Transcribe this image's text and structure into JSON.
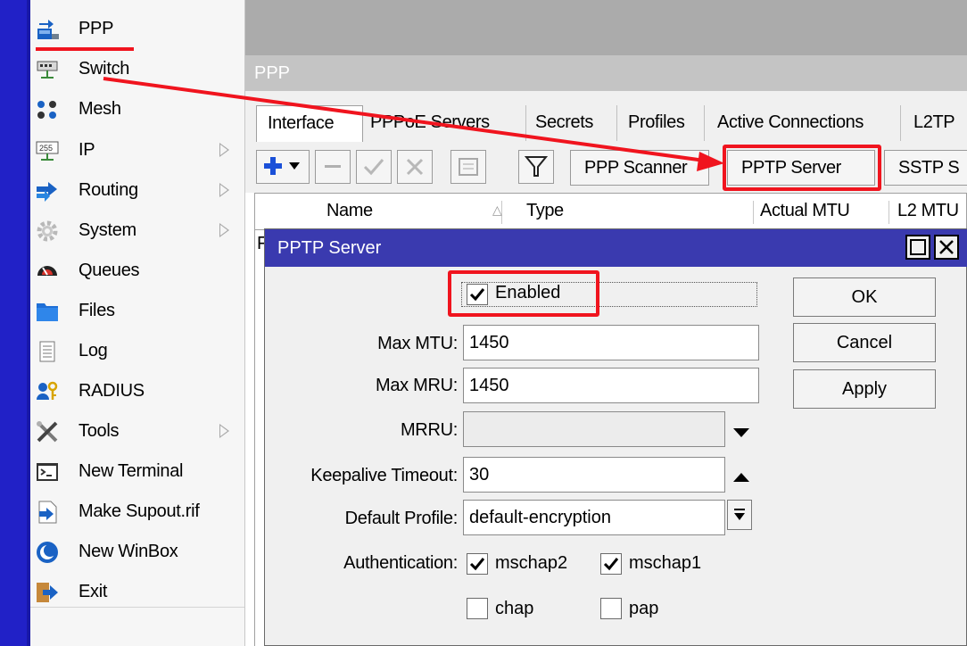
{
  "menu": {
    "items": [
      {
        "label": "PPP",
        "icon": "ppp-icon",
        "has_submenu": false
      },
      {
        "label": "Switch",
        "icon": "switch-icon",
        "has_submenu": false
      },
      {
        "label": "Mesh",
        "icon": "mesh-icon",
        "has_submenu": false
      },
      {
        "label": "IP",
        "icon": "ip-icon",
        "has_submenu": true
      },
      {
        "label": "Routing",
        "icon": "routing-icon",
        "has_submenu": true
      },
      {
        "label": "System",
        "icon": "gear-icon",
        "has_submenu": true
      },
      {
        "label": "Queues",
        "icon": "queues-icon",
        "has_submenu": false
      },
      {
        "label": "Files",
        "icon": "folder-icon",
        "has_submenu": false
      },
      {
        "label": "Log",
        "icon": "log-icon",
        "has_submenu": false
      },
      {
        "label": "RADIUS",
        "icon": "radius-icon",
        "has_submenu": false
      },
      {
        "label": "Tools",
        "icon": "tools-icon",
        "has_submenu": true
      },
      {
        "label": "New Terminal",
        "icon": "terminal-icon",
        "has_submenu": false
      },
      {
        "label": "Make Supout.rif",
        "icon": "supout-icon",
        "has_submenu": false
      },
      {
        "label": "New WinBox",
        "icon": "winbox-icon",
        "has_submenu": false
      },
      {
        "label": "Exit",
        "icon": "exit-icon",
        "has_submenu": false
      }
    ],
    "ip_icon_text": "255"
  },
  "ppp_window": {
    "title": "PPP",
    "tabs": [
      "Interface",
      "PPPoE Servers",
      "Secrets",
      "Profiles",
      "Active Connections",
      "L2TP"
    ],
    "toolbar": {
      "scanner_label": "PPP Scanner",
      "pptp_label": "PPTP Server",
      "sstp_label": "SSTP S"
    },
    "columns": {
      "flag": "",
      "name": "Name",
      "type": "Type",
      "actual_mtu": "Actual MTU",
      "l2_mtu": "L2 MTU"
    },
    "row_fragment": "F"
  },
  "dialog": {
    "title": "PPTP Server",
    "enabled": {
      "label": "Enabled",
      "checked": true
    },
    "fields": {
      "max_mtu": {
        "label": "Max MTU:",
        "value": "1450"
      },
      "max_mru": {
        "label": "Max MRU:",
        "value": "1450"
      },
      "mrru": {
        "label": "MRRU:",
        "value": ""
      },
      "keepalive": {
        "label": "Keepalive Timeout:",
        "value": "30"
      },
      "default_profile": {
        "label": "Default Profile:",
        "value": "default-encryption"
      }
    },
    "authentication": {
      "label": "Authentication:",
      "options": [
        {
          "label": "mschap2",
          "checked": true
        },
        {
          "label": "mschap1",
          "checked": true
        },
        {
          "label": "chap",
          "checked": false
        },
        {
          "label": "pap",
          "checked": false
        }
      ]
    },
    "buttons": {
      "ok": "OK",
      "cancel": "Cancel",
      "apply": "Apply"
    }
  },
  "colors": {
    "highlight": "#f0141e",
    "dialog_title": "#3a3aaf",
    "accent_blue": "#2121c7"
  }
}
